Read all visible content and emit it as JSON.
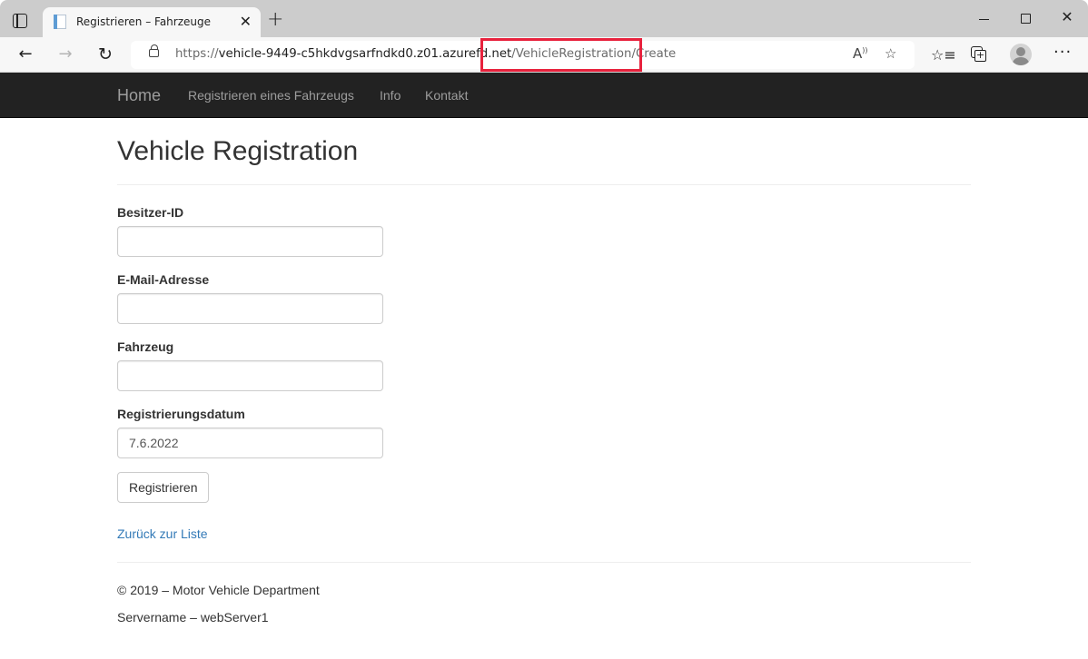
{
  "browser": {
    "tab_title": "Registrieren – Fahrzeuge",
    "tab_close": "✕",
    "new_tab": "+",
    "url_proto": "https://",
    "url_host": "vehicle-9449-c5hkdvgsarfndkd0.z01.azurefd.net",
    "url_path": "/VehicleRegistration/Create",
    "highlight_color": "#e8223d",
    "icons": {
      "tab_actions": "tab-actions-icon",
      "back": "←",
      "forward": "→",
      "refresh": "↻",
      "read_aloud": "A",
      "add_favorite": "☆",
      "favorites": "☆≡",
      "more": "···",
      "close": "✕"
    }
  },
  "navbar": {
    "brand": "Home",
    "links": [
      "Registrieren eines Fahrzeugs",
      "Info",
      "Kontakt"
    ]
  },
  "page": {
    "title": "Vehicle Registration",
    "fields": [
      {
        "label": "Besitzer-ID",
        "value": ""
      },
      {
        "label": "E-Mail-Adresse",
        "value": ""
      },
      {
        "label": "Fahrzeug",
        "value": ""
      },
      {
        "label": "Registrierungsdatum",
        "value": "7.6.2022"
      }
    ],
    "submit_label": "Registrieren",
    "back_link": "Zurück zur Liste",
    "link_color": "#337ab7"
  },
  "footer": {
    "copyright": "© 2019 – Motor Vehicle Department",
    "server": "Servername – webServer1"
  }
}
